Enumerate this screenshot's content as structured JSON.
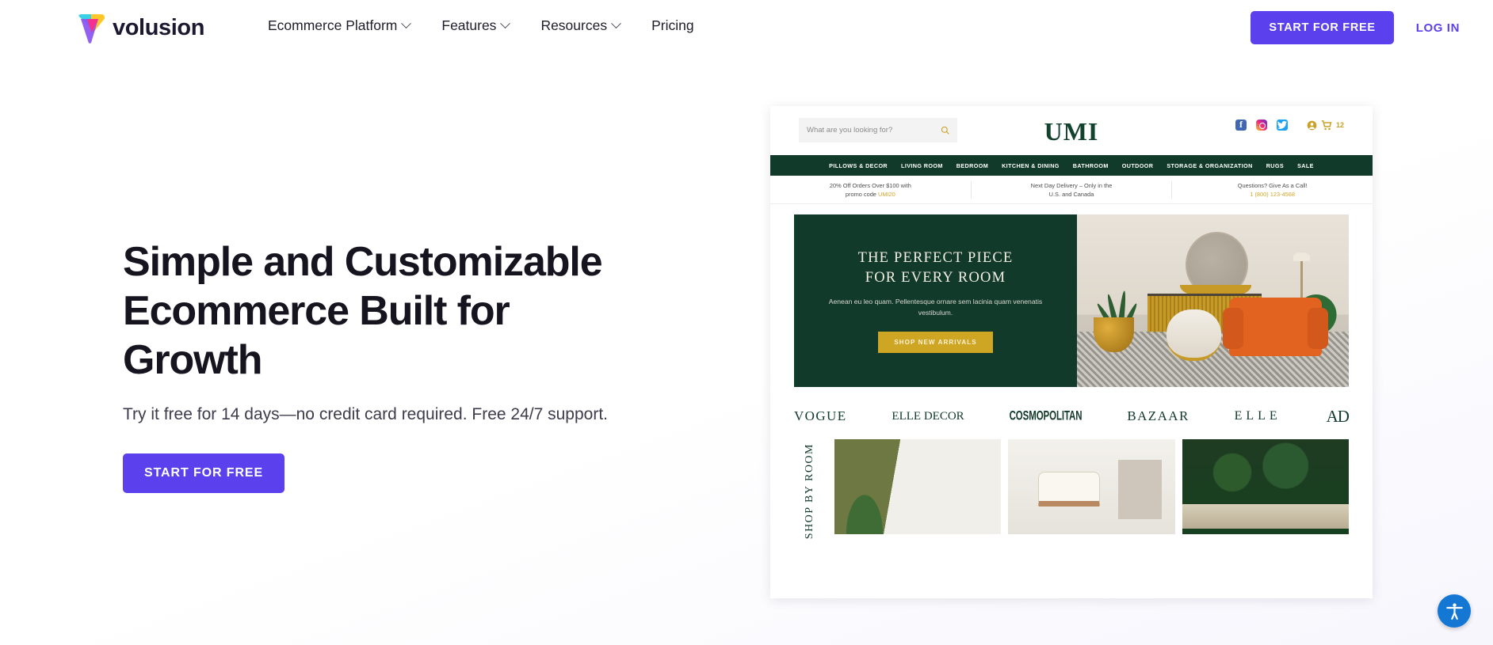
{
  "topnav": {
    "brand": "volusion",
    "logo_icon": "volusion-triangle-logo",
    "links": [
      {
        "label": "Ecommerce Platform",
        "has_caret": true
      },
      {
        "label": "Features",
        "has_caret": true
      },
      {
        "label": "Resources",
        "has_caret": true
      },
      {
        "label": "Pricing",
        "has_caret": false
      }
    ],
    "cta_label": "START FOR FREE",
    "login_label": "LOG IN",
    "accent_color": "#5b41ee"
  },
  "hero": {
    "title_line1": "Simple and Customizable",
    "title_line2": "Ecommerce Built for Growth",
    "subtitle": "Try it free for 14 days—no credit card required. Free 24/7 support.",
    "cta_label": "START FOR FREE"
  },
  "mockup": {
    "search_placeholder": "What are you looking for?",
    "store_name": "UMI",
    "cart_count": "12",
    "social": [
      "facebook-icon",
      "instagram-icon",
      "twitter-icon"
    ],
    "nav": [
      "PILLOWS & DECOR",
      "LIVING ROOM",
      "BEDROOM",
      "KITCHEN & DINING",
      "BATHROOM",
      "OUTDOOR",
      "STORAGE & ORGANIZATION",
      "RUGS",
      "SALE"
    ],
    "promos": [
      {
        "line1": "20% Off Orders Over $100 with",
        "line2": "promo code ",
        "highlight": "UMI20"
      },
      {
        "line1": "Next Day Delivery – Only in the",
        "line2": "U.S. and Canada",
        "highlight": ""
      },
      {
        "line1": "Questions? Give As a Call!",
        "line2": "",
        "highlight": "1 (800) 123-4568"
      }
    ],
    "banner": {
      "title_line1": "THE PERFECT PIECE",
      "title_line2": "FOR EVERY ROOM",
      "description": "Aenean eu leo quam. Pellentesque ornare sem lacinia quam venenatis vestibulum.",
      "button_label": "SHOP NEW ARRIVALS",
      "background_color": "#123a2b",
      "button_color": "#cfa524"
    },
    "brands": [
      "VOGUE",
      "ELLE DECOR",
      "COSMOPOLITAN",
      "BAZAAR",
      "ELLE",
      "AD"
    ],
    "shop_by_room_label": "SHOP BY ROOM",
    "green_color": "#123a2b",
    "gold_color": "#c9a227"
  },
  "accessibility": {
    "icon": "accessibility-person-icon",
    "color": "#1577d4"
  }
}
